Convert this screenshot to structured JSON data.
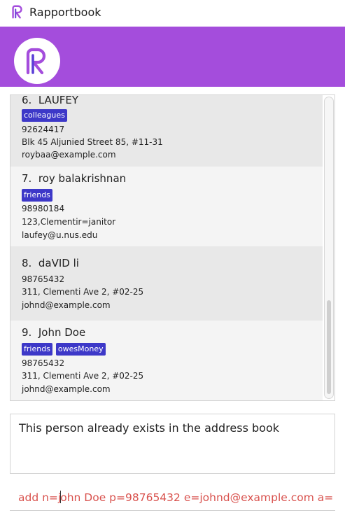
{
  "window": {
    "title": "Rapportbook",
    "app_icon": "rapportbook-logo-icon"
  },
  "header": {
    "logo": "rapportbook-logo-icon",
    "brand_color": "#a44ddc"
  },
  "persons": [
    {
      "index": "6.",
      "name": "LAUFEY",
      "tags": [
        "colleagues"
      ],
      "phone": "92624417",
      "address": "Blk 45 Aljunied Street 85, #11-31",
      "email": "roybaa@example.com"
    },
    {
      "index": "7.",
      "name": "roy balakrishnan",
      "tags": [
        "friends"
      ],
      "phone": "98980184",
      "address": "123,Clementir=janitor",
      "email": "laufey@u.nus.edu"
    },
    {
      "index": "8.",
      "name": "daVID li",
      "tags": [],
      "phone": "98765432",
      "address": "311, Clementi Ave 2, #02-25",
      "email": "johnd@example.com"
    },
    {
      "index": "9.",
      "name": "John Doe",
      "tags": [
        "friends",
        "owesMoney"
      ],
      "phone": "98765432",
      "address": "311, Clementi Ave 2, #02-25",
      "email": "johnd@example.com"
    }
  ],
  "result": {
    "message": "This person already exists in the address book"
  },
  "command": {
    "before_caret": "add n=j",
    "after_caret": "ohn Doe p=98765432 e=johnd@example.com a=",
    "error_color": "#d9534f"
  },
  "colors": {
    "tag": "#3d38c8"
  }
}
